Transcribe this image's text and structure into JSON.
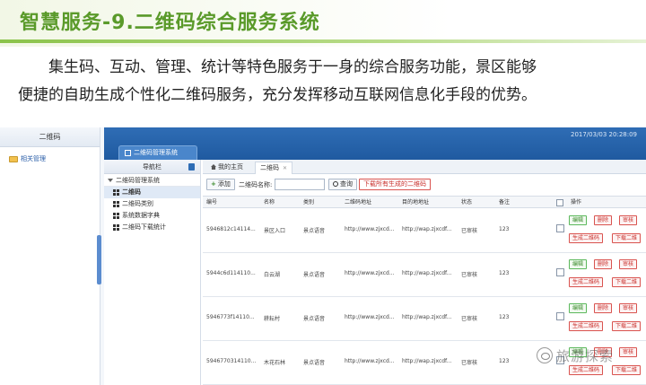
{
  "header": {
    "title": "智慧服务-9.二维码综合服务系统"
  },
  "intro": {
    "line1": "集生码、互动、管理、统计等特色服务于一身的综合服务功能，景区能够",
    "line2": "便捷的自助生成个性化二维码服务，充分发挥移动互联网信息化手段的优势。"
  },
  "left_panel": {
    "title": "二维码",
    "item": "相关管理"
  },
  "app": {
    "tab_label": "二维码管理系统",
    "datetime": "2017/03/03 20:28:09"
  },
  "nav": {
    "title": "导航栏",
    "group": "二维码管理系统",
    "items": [
      "二维码",
      "二维码类别",
      "系统数据字典",
      "二维码下载统计"
    ]
  },
  "content": {
    "tabs": {
      "home": "我的主页",
      "current": "二维码"
    },
    "toolbar": {
      "add": "添加",
      "name_label": "二维码名称:",
      "search": "查询",
      "download_all": "下载所有生成的二维码"
    },
    "columns": [
      "编号",
      "名称",
      "类别",
      "二维码地址",
      "目的地地址",
      "状态",
      "备注",
      "操作"
    ],
    "rows": [
      {
        "id": "5946812c14114...",
        "name": "景区入口",
        "category": "景点语音",
        "qr_url": "http://www.zjxcd...",
        "target_url": "http://wap.zjxcdf...",
        "status": "已审核",
        "note": "123"
      },
      {
        "id": "5944c6d114110...",
        "name": "白云湖",
        "category": "景点语音",
        "qr_url": "http://www.zjxcd...",
        "target_url": "http://wap.zjxcdf...",
        "status": "已审核",
        "note": "123"
      },
      {
        "id": "5946773f14110...",
        "name": "耕耘村",
        "category": "景点语音",
        "qr_url": "http://www.zjxcd...",
        "target_url": "http://wap.zjxcdf...",
        "status": "已审核",
        "note": "123"
      },
      {
        "id": "5946770314110...",
        "name": "木花石林",
        "category": "景点语音",
        "qr_url": "http://www.zjxcd...",
        "target_url": "http://wap.zjxcdf...",
        "status": "已审核",
        "note": "123"
      }
    ],
    "actions": {
      "edit": "编辑",
      "delete": "删除",
      "audit": "审核",
      "generate": "生成二维码",
      "download": "下载二维"
    }
  },
  "watermark": {
    "text": "旅游探索"
  }
}
